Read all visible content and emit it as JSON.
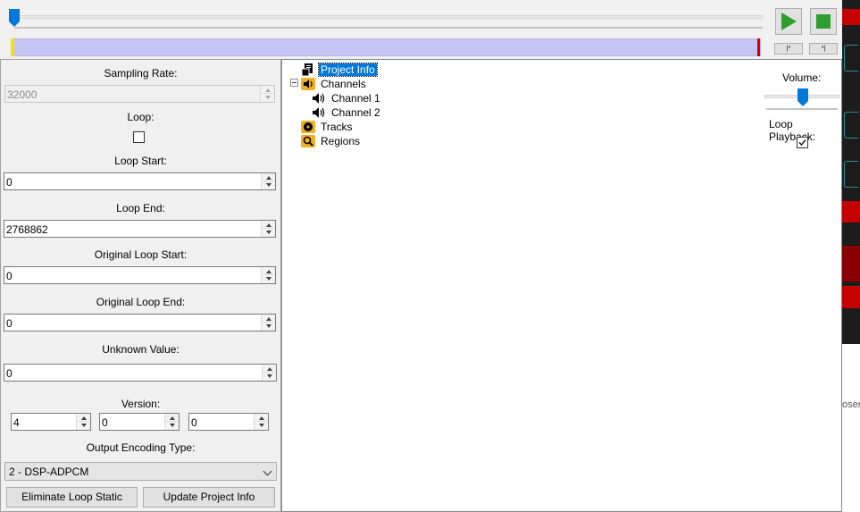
{
  "transport": {
    "play_icon": "play-icon",
    "stop_icon": "stop-icon",
    "set_loop_start_label": "|*",
    "set_loop_end_label": "*|",
    "accent_play": "#2e9e2e",
    "accent_stop": "#2e9e2e"
  },
  "properties": {
    "sampling_rate_label": "Sampling Rate:",
    "sampling_rate_value": "32000",
    "loop_label": "Loop:",
    "loop_checked": false,
    "loop_start_label": "Loop Start:",
    "loop_start_value": "0",
    "loop_end_label": "Loop End:",
    "loop_end_value": "2768862",
    "original_loop_start_label": "Original Loop Start:",
    "original_loop_start_value": "0",
    "original_loop_end_label": "Original Loop End:",
    "original_loop_end_value": "0",
    "unknown_value_label": "Unknown Value:",
    "unknown_value_value": "0",
    "version_label": "Version:",
    "version_values": [
      "4",
      "0",
      "0"
    ],
    "output_encoding_label": "Output Encoding Type:",
    "output_encoding_value": "2 - DSP-ADPCM",
    "eliminate_button": "Eliminate Loop Static",
    "update_button": "Update Project Info"
  },
  "tree": {
    "project_info": "Project Info",
    "channels": "Channels",
    "channel_1": "Channel 1",
    "channel_2": "Channel 2",
    "tracks": "Tracks",
    "regions": "Regions"
  },
  "playback": {
    "volume_label": "Volume:",
    "loop_playback_label": "Loop Playback:",
    "loop_playback_checked": true
  },
  "side_text": "oser"
}
